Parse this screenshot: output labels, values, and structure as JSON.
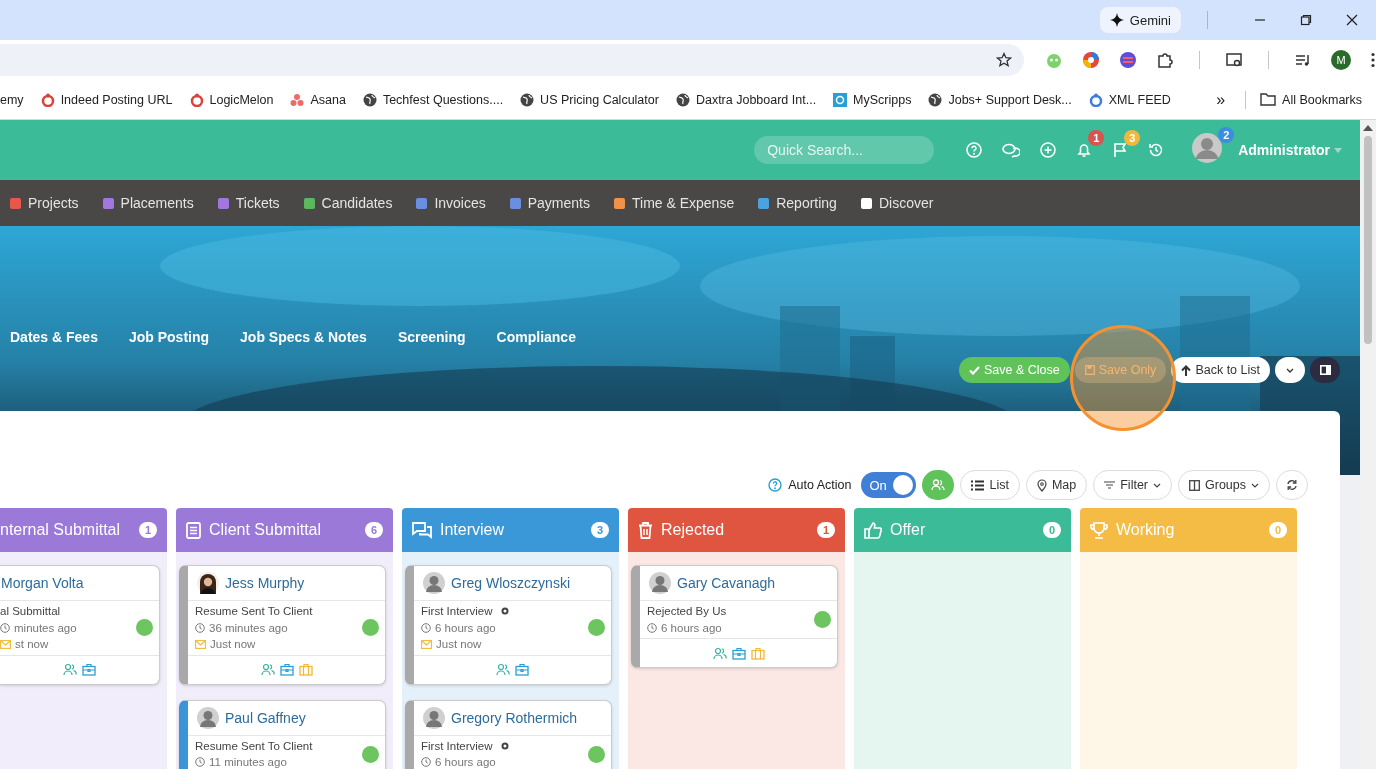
{
  "browser": {
    "gemini": "Gemini",
    "profile_initial": "M",
    "bookmarks": [
      {
        "label": "emy",
        "kind": "none"
      },
      {
        "label": "Indeed Posting URL",
        "kind": "mark",
        "color": "#d9443a"
      },
      {
        "label": "LogicMelon",
        "kind": "mark",
        "color": "#d9443a"
      },
      {
        "label": "Asana",
        "kind": "dots",
        "color": "#f06a6a"
      },
      {
        "label": "Techfest Questions....",
        "kind": "globe"
      },
      {
        "label": "US Pricing Calculator",
        "kind": "globe"
      },
      {
        "label": "Daxtra Jobboard Int...",
        "kind": "globe"
      },
      {
        "label": "MyScripps",
        "kind": "square",
        "color": "#2a9fd6"
      },
      {
        "label": "Jobs+ Support Desk...",
        "kind": "globe"
      },
      {
        "label": "XML FEED",
        "kind": "mark",
        "color": "#3b7de0"
      }
    ],
    "more": "»",
    "all_bookmarks": "All Bookmarks"
  },
  "header": {
    "search": {
      "placeholder": "Quick Search..."
    },
    "notifications": "1",
    "flags": "3",
    "messages": "2",
    "user": "Administrator"
  },
  "nav": [
    {
      "label": "Projects",
      "color": "#e8584a"
    },
    {
      "label": "Placements",
      "color": "#a278e0"
    },
    {
      "label": "Tickets",
      "color": "#a278e0"
    },
    {
      "label": "Candidates",
      "color": "#5cb85c"
    },
    {
      "label": "Invoices",
      "color": "#6a8fe0"
    },
    {
      "label": "Payments",
      "color": "#6a8fe0"
    },
    {
      "label": "Time & Expense",
      "color": "#f0924a"
    },
    {
      "label": "Reporting",
      "color": "#4aa3df"
    },
    {
      "label": "Discover",
      "color": "#ffffff"
    }
  ],
  "tabs": [
    "Dates & Fees",
    "Job Posting",
    "Job Specs & Notes",
    "Screening",
    "Compliance"
  ],
  "actions": {
    "save_close": "Save & Close",
    "save_only": "Save Only",
    "back": "Back to List"
  },
  "toolbar": {
    "auto_action": "Auto Action",
    "toggle": {
      "label": "On",
      "on": true
    },
    "list": "List",
    "map": "Map",
    "filter": "Filter",
    "groups": "Groups"
  },
  "columns": [
    {
      "title": "nternal Submittal",
      "count": "1",
      "kind": "internal",
      "color": "#9a79d8",
      "cards": [
        {
          "name": "Morgan Volta",
          "status": "al Submittal",
          "time": "minutes ago",
          "emailed": "st now",
          "marker": false,
          "job": false
        }
      ]
    },
    {
      "title": "Client Submittal",
      "count": "6",
      "kind": "client",
      "color": "#9a79d8",
      "cards": [
        {
          "name": "Jess Murphy",
          "photo": true,
          "color": "#a9a9a9",
          "status": "Resume Sent To Client",
          "time": "36 minutes ago",
          "emailed": "Just now",
          "marker": false,
          "job": true
        },
        {
          "name": "Paul Gaffney",
          "photo": false,
          "color": "#3a95d8",
          "status": "Resume Sent To Client",
          "time": "11 minutes ago",
          "marker": false
        }
      ]
    },
    {
      "title": "Interview",
      "count": "3",
      "kind": "interview",
      "color": "#3a98d8",
      "cards": [
        {
          "name": "Greg Wloszczynski",
          "photo": false,
          "color": "#a9a9a9",
          "status": "First Interview",
          "time": "6 hours ago",
          "emailed": "Just now",
          "marker": true,
          "job": false
        },
        {
          "name": "Gregory Rothermich",
          "photo": false,
          "color": "#a9a9a9",
          "status": "First Interview",
          "time": "6 hours ago",
          "marker": true
        }
      ]
    },
    {
      "title": "Rejected",
      "count": "1",
      "kind": "rejected",
      "color": "#e0553f",
      "cards": [
        {
          "name": "Gary Cavanagh",
          "photo": false,
          "color": "#a9a9a9",
          "status": "Rejected By Us",
          "time": "6 hours ago",
          "marker": false,
          "job": true
        }
      ]
    },
    {
      "title": "Offer",
      "count": "0",
      "kind": "offer",
      "color": "#3bbb98"
    },
    {
      "title": "Working",
      "count": "0",
      "kind": "working",
      "color": "#f4bc45"
    }
  ]
}
